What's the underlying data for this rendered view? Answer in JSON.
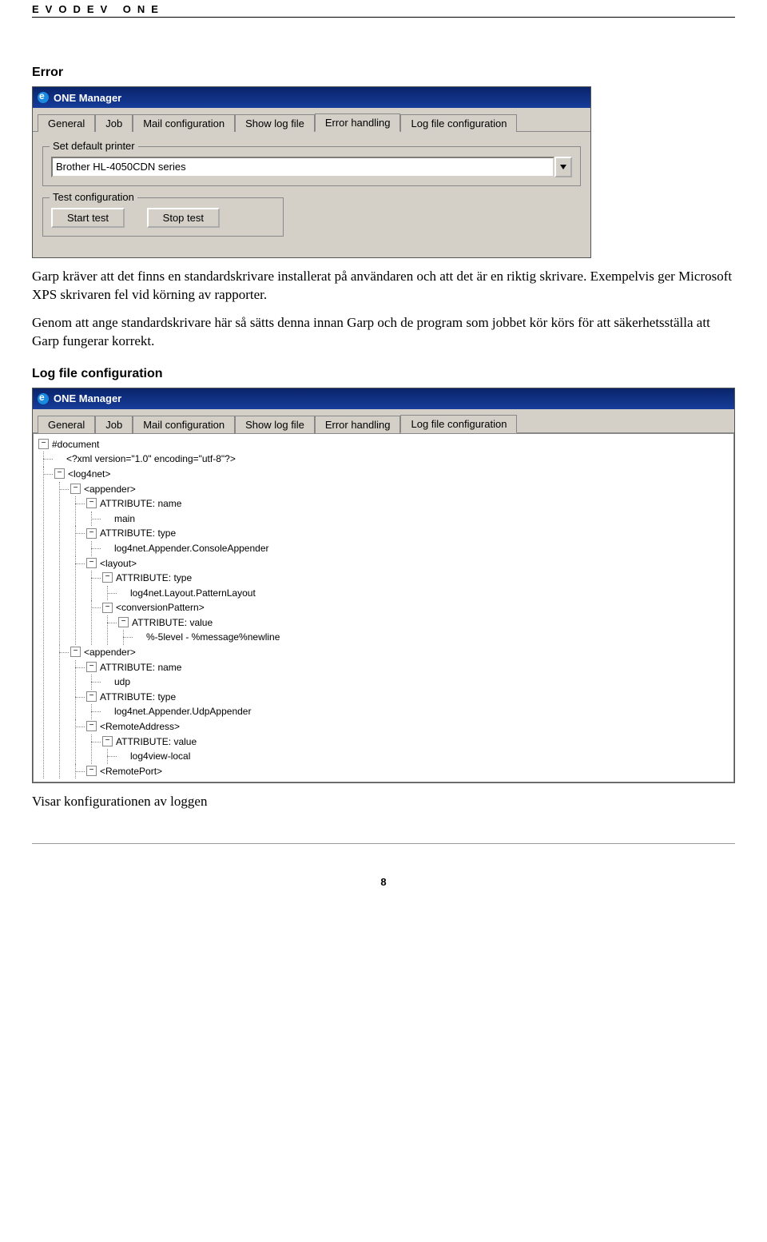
{
  "brand": "EVODEV ONE",
  "sections": {
    "error_title": "Error",
    "logfile_title": "Log file configuration"
  },
  "error_window": {
    "title": "ONE Manager",
    "tabs": [
      "General",
      "Job",
      "Mail configuration",
      "Show log file",
      "Error handling",
      "Log file configuration"
    ],
    "active_tab": "Error handling",
    "group_default_printer": "Set default printer",
    "printer_value": "Brother HL-4050CDN series",
    "group_test": "Test configuration",
    "btn_start": "Start test",
    "btn_stop": "Stop test"
  },
  "error_paragraphs": {
    "p1": "Garp kräver att det finns en standardskrivare installerat på användaren och att det är en riktig skrivare. Exempelvis ger Microsoft XPS skrivaren fel vid körning av rapporter.",
    "p2": "Genom att ange standardskrivare här så sätts denna innan Garp och de program som jobbet kör körs för att säkerhetsställa att Garp fungerar korrekt."
  },
  "log_window": {
    "title": "ONE Manager",
    "tabs": [
      "General",
      "Job",
      "Mail configuration",
      "Show log file",
      "Error handling",
      "Log file configuration"
    ],
    "active_tab": "Log file configuration",
    "tree": {
      "doc": "#document",
      "xml": "<?xml version=\"1.0\" encoding=\"utf-8\"?>",
      "log4net": "<log4net>",
      "appender": "<appender>",
      "attr_name": "ATTRIBUTE: name",
      "main": "main",
      "attr_type": "ATTRIBUTE: type",
      "console_app": "log4net.Appender.ConsoleAppender",
      "layout": "<layout>",
      "pattern_layout": "log4net.Layout.PatternLayout",
      "conv_pattern": "<conversionPattern>",
      "attr_value": "ATTRIBUTE: value",
      "pattern_val": "%-5level - %message%newline",
      "udp": "udp",
      "udp_app": "log4net.Appender.UdpAppender",
      "remote_addr": "<RemoteAddress>",
      "log4view": "log4view-local",
      "remote_port": "<RemotePort>"
    }
  },
  "log_caption": "Visar konfigurationen av loggen",
  "page_number": "8"
}
